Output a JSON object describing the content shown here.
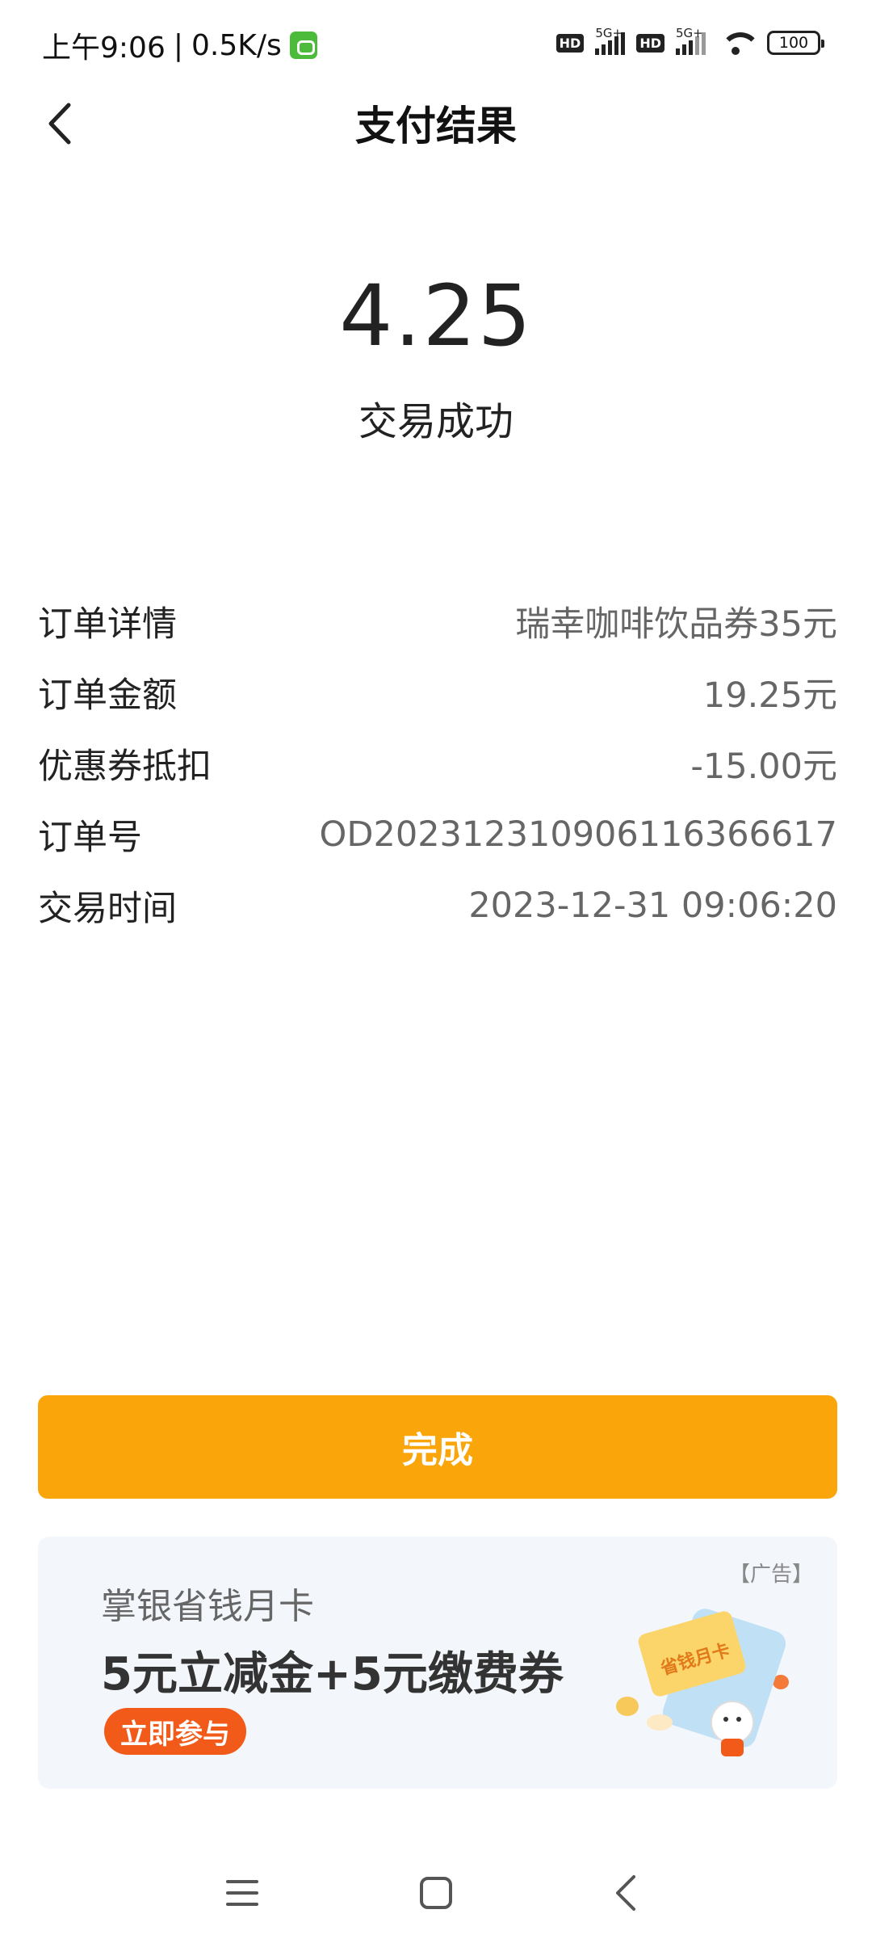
{
  "status_bar": {
    "time": "上午9:06",
    "separator": "|",
    "speed": "0.5K/s",
    "sim1_tag": "5G+",
    "sim2_tag": "5G+",
    "hd1": "HD",
    "hd2": "HD",
    "battery": "100"
  },
  "header": {
    "title": "支付结果",
    "back_icon": "chevron-left-icon"
  },
  "result": {
    "amount": "4.25",
    "status": "交易成功"
  },
  "details": [
    {
      "label": "订单详情",
      "value": "瑞幸咖啡饮品券35元"
    },
    {
      "label": "订单金额",
      "value": "19.25元"
    },
    {
      "label": "优惠券抵扣",
      "value": "-15.00元"
    },
    {
      "label": "订单号",
      "value": "OD20231231090611636661​7"
    },
    {
      "label": "交易时间",
      "value": "2023-12-31 09:06:20"
    }
  ],
  "done_button": {
    "label": "完成",
    "color": "#faa50a"
  },
  "ad": {
    "tag": "【广告】",
    "subtitle": "掌银省钱月卡",
    "title": "5元立减金+5元缴费券",
    "cta": "立即参与",
    "card_text": "省钱月卡",
    "cta_color": "#f25a1a"
  },
  "nav": {
    "menu_icon": "menu-icon",
    "home_icon": "home-square-icon",
    "back_icon": "back-triangle-icon"
  }
}
